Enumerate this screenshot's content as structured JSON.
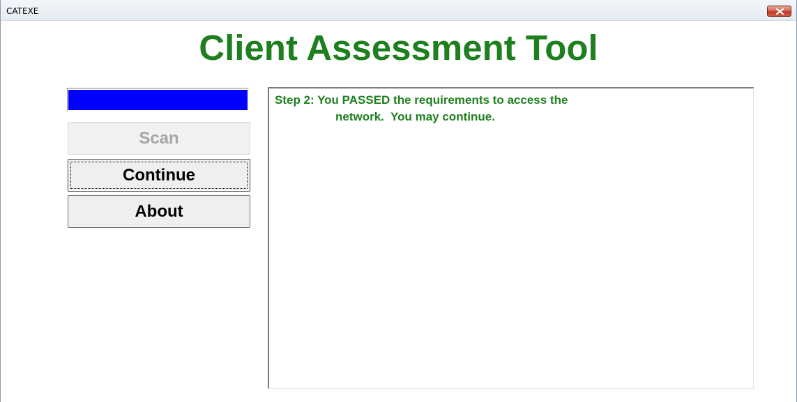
{
  "window": {
    "title": "CATEXE",
    "close_icon": "close-icon"
  },
  "app": {
    "title": "Client Assessment Tool",
    "accent_color": "#1e7f1e"
  },
  "progress": {
    "fraction": 1.0,
    "color": "#0000ff"
  },
  "buttons": {
    "scan": "Scan",
    "continue": "Continue",
    "about": "About"
  },
  "output": {
    "lines": [
      "Step 2: You PASSED the requirements to access the",
      "network.  You may continue."
    ]
  }
}
